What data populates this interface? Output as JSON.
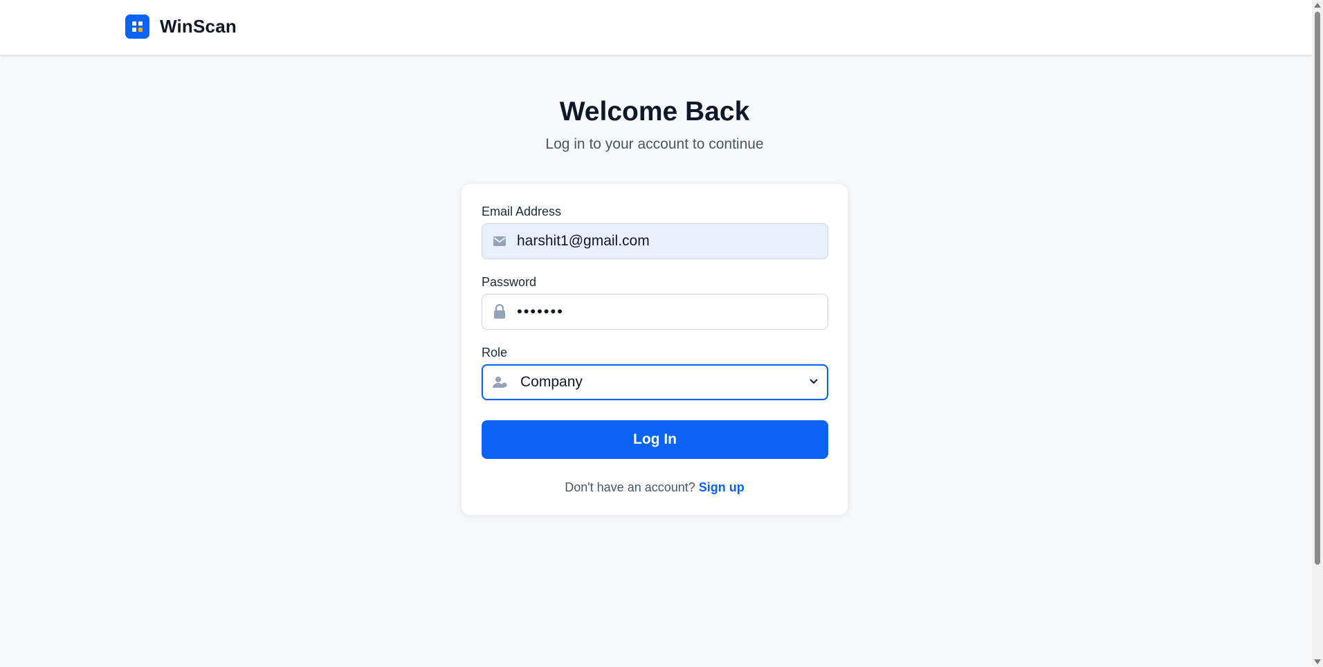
{
  "brand": {
    "name": "WinScan"
  },
  "heading": {
    "title": "Welcome Back",
    "subtitle": "Log in to your account to continue"
  },
  "form": {
    "email": {
      "label": "Email Address",
      "value": "harshit1@gmail.com",
      "icon": "envelope-icon"
    },
    "password": {
      "label": "Password",
      "masked_value": "•••••••",
      "icon": "lock-icon"
    },
    "role": {
      "label": "Role",
      "selected": "Company",
      "icon": "user-role-icon"
    },
    "submit_label": "Log In",
    "signup_prompt": "Don't have an account?",
    "signup_link": "Sign up"
  },
  "colors": {
    "accent": "#0b63f6",
    "background": "#f8f9fb",
    "email_autofill_bg": "#e8f0fe"
  }
}
